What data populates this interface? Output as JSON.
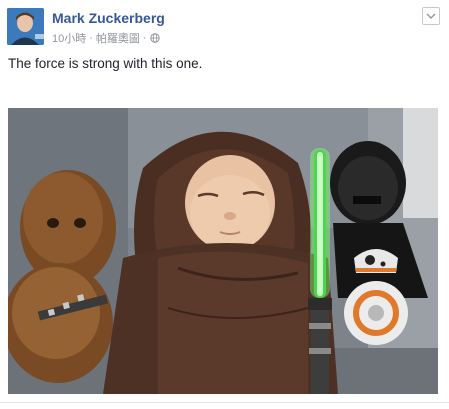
{
  "post": {
    "author_name": "Mark Zuckerberg",
    "timestamp": "10小時",
    "location": "帕羅奧圖",
    "separator": "·",
    "privacy_icon": "globe-icon",
    "menu_icon": "chevron-down-icon",
    "status_text": "The force is strong with this one.",
    "photo": "baby-in-jedi-robe-photo"
  },
  "colors": {
    "author_link": "#365899",
    "meta_text": "#90949c",
    "body_text": "#1d2129"
  }
}
